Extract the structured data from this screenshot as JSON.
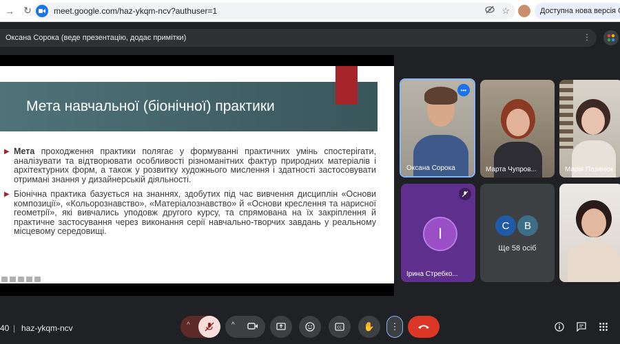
{
  "browser": {
    "url": "meet.google.com/haz-ykqm-ncv?authuser=1",
    "update_label": "Доступна нова версія Chrome"
  },
  "banner": {
    "text": "Оксана Сорока (веде презентацію, додає примітки)"
  },
  "slide": {
    "title": "Мета навчальної (біонічної) практики",
    "p1_bold": "Мета",
    "p1_rest": " проходження практики полягає у формуванні практичних умінь спостерігати, аналізувати та відтворювати особливості різноманітних фактур природних матеріалів і архітектурних форм, а також у розвитку художнього мислення і здатності застосовувати отримані знання у дизайнерській діяльності.",
    "p2": "Біонічна практика базується на знаннях, здобутих під час вивчення дисциплін «Основи композиції», «Кольорознавство», «Матеріалознавство» й «Основи креслення та нарисної геометрії», які вивчались уподовж другого курсу, та спрямована на їх закріплення й практичне застосування через виконання серії навчально-творчих завдань у реальному місцевому середовищі."
  },
  "participants": [
    {
      "name": "Оксана Сорока"
    },
    {
      "name": "Марта Чупров..."
    },
    {
      "name": "Марія Пазинюк"
    },
    {
      "name": "Ірина Стребко...",
      "initial": "І"
    },
    {
      "others": "Ще 58 осіб",
      "initials": [
        "С",
        "В"
      ]
    },
    {
      "name": ""
    }
  ],
  "toolbar": {
    "time": "40",
    "code": "haz-ykqm-ncv"
  },
  "colors": {
    "accent": "#a5252a",
    "header": "#4f7379",
    "end_call": "#dc3626"
  }
}
